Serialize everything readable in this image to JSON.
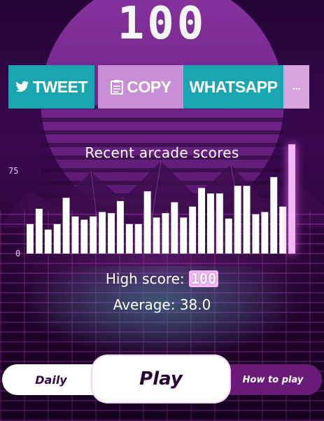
{
  "score": "100",
  "share": {
    "tweet_label": "TWEET",
    "copy_label": "COPY",
    "whatsapp_label": "WHATSAPP",
    "more_label": "..."
  },
  "chart_data": {
    "type": "bar",
    "title": "Recent arcade scores",
    "y_ticks": [
      "75",
      "0"
    ],
    "ylim": [
      0,
      100
    ],
    "values": [
      27,
      41,
      22,
      27,
      51,
      34,
      31,
      34,
      38,
      37,
      48,
      27,
      27,
      57,
      33,
      37,
      47,
      33,
      43,
      60,
      55,
      55,
      32,
      62,
      62,
      36,
      38,
      70,
      43,
      100
    ],
    "highlight_index": 29,
    "colors": {
      "bar": "#ffffff",
      "highlight": "#f2b8f6"
    }
  },
  "stats": {
    "high_score_label": "High score:",
    "high_score_value": "100",
    "average_label": "Average: 38.0"
  },
  "nav": {
    "daily_label": "Daily",
    "play_label": "Play",
    "howto_label": "How to play"
  },
  "colors": {
    "teal": "#1aa6b0",
    "pink": "#c98fd6",
    "purple_bg": "#2a0638"
  }
}
